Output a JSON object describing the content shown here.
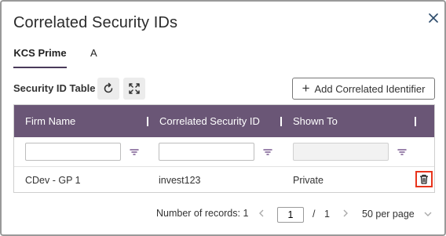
{
  "dialog": {
    "title": "Correlated Security IDs",
    "close_icon": "close-icon"
  },
  "tabs": [
    {
      "label": "KCS Prime",
      "active": true
    },
    {
      "label": "A",
      "active": false
    }
  ],
  "toolbar": {
    "table_title": "Security ID Table",
    "refresh_icon": "refresh-icon",
    "expand_icon": "expand-icon",
    "add_label": "Add Correlated Identifier"
  },
  "grid": {
    "header_color": "#6a5676",
    "columns": [
      "Firm Name",
      "Correlated Security ID",
      "Shown To"
    ],
    "filters": [
      {
        "value": "",
        "enabled": true
      },
      {
        "value": "",
        "enabled": true
      },
      {
        "value": "",
        "enabled": false
      }
    ],
    "rows": [
      {
        "firm_name": "CDev - GP 1",
        "correlated_id": "invest123",
        "shown_to": "Private",
        "action_icon": "trash-icon"
      }
    ]
  },
  "pager": {
    "records_label": "Number of records: 1",
    "page_value": "1",
    "separator": "/",
    "total_pages": "1",
    "per_page": "50 per page"
  }
}
